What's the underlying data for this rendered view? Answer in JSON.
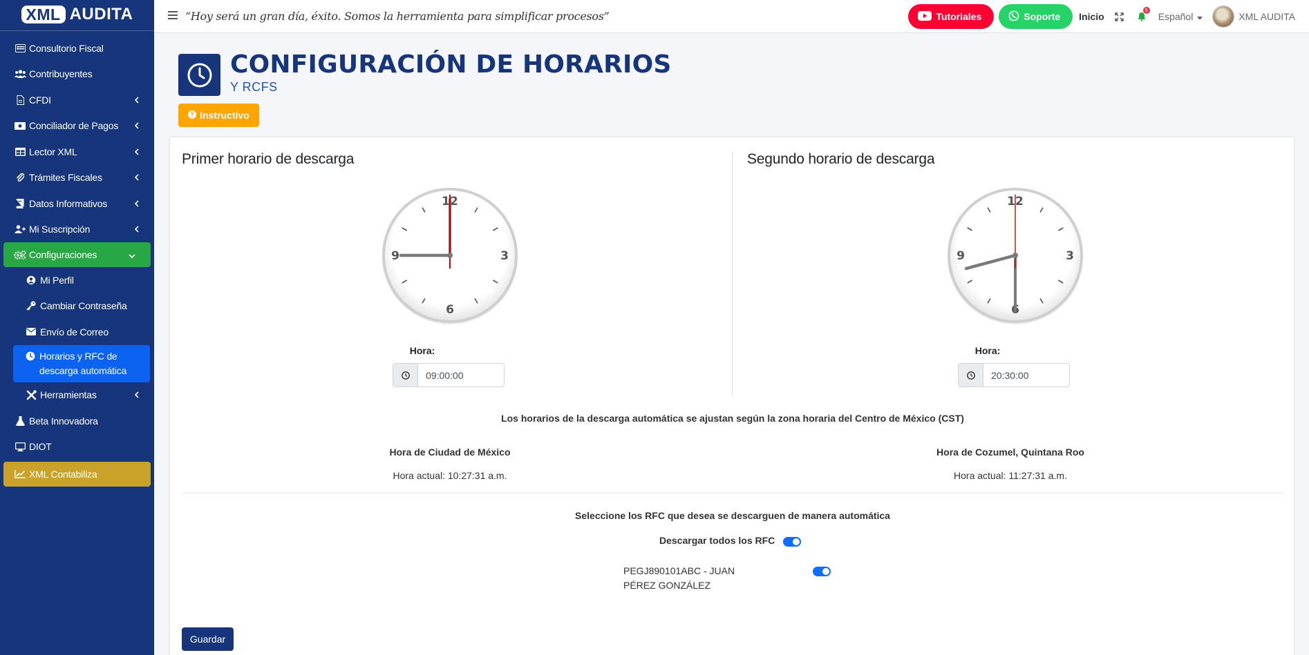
{
  "brand": {
    "part1": "XML",
    "part2": "AUDITA"
  },
  "topbar": {
    "motto": "“Hoy será un gran día, éxito. Somos la herramienta para simplificar procesos”",
    "tutoriales": "Tutoriales",
    "soporte": "Soporte",
    "inicio": "Inicio",
    "notif_count": "5",
    "language": "Español",
    "user": "XML AUDITA"
  },
  "sidebar": {
    "items": [
      {
        "label": "Consultorio Fiscal",
        "icon": "invoice-icon"
      },
      {
        "label": "Contribuyentes",
        "icon": "users-icon"
      },
      {
        "label": "CFDI",
        "icon": "file-icon"
      },
      {
        "label": "Conciliador de Pagos",
        "icon": "money-icon"
      },
      {
        "label": "Lector XML",
        "icon": "table-icon"
      },
      {
        "label": "Trámites Fiscales",
        "icon": "paperclip-icon"
      },
      {
        "label": "Datos Informativos",
        "icon": "book-icon"
      },
      {
        "label": "Mi Suscripción",
        "icon": "user-plus-icon"
      },
      {
        "label": "Configuraciones",
        "icon": "gears-icon"
      },
      {
        "label": "Mi Perfil",
        "icon": "user-circle-icon"
      },
      {
        "label": "Cambiar Contraseña",
        "icon": "key-icon"
      },
      {
        "label": "Envío de Correo",
        "icon": "envelope-icon"
      },
      {
        "label": "Horarios y RFC de descarga automática",
        "icon": "clock-icon"
      },
      {
        "label": "Herramientas",
        "icon": "tools-icon"
      },
      {
        "label": "Beta Innovadora",
        "icon": "flask-icon"
      },
      {
        "label": "DIOT",
        "icon": "desktop-icon"
      },
      {
        "label": "XML Contabiliza",
        "icon": "chart-line-icon"
      }
    ]
  },
  "header": {
    "title": "CONFIGURACIÓN DE HORARIOS",
    "subtitle": "Y RCFS",
    "instructivo": "Instructivo"
  },
  "schedules": {
    "first": {
      "title": "Primer horario de descarga",
      "label": "Hora:",
      "value": "09:00:00"
    },
    "second": {
      "title": "Segundo horario de descarga",
      "label": "Hora:",
      "value": "20:30:00"
    }
  },
  "clock_numbers": {
    "n12": "12",
    "n3": "3",
    "n6": "6",
    "n9": "9"
  },
  "timezone": {
    "note": "Los horarios de la descarga automática se ajustan según la zona horaria del Centro de México (CST)",
    "city1": "Hora de Ciudad de México",
    "now1": "Hora actual: 10:27:31 a.m.",
    "city2": "Hora de Cozumel, Quintana Roo",
    "now2": "Hora actual: 11:27:31 a.m."
  },
  "rfc": {
    "note": "Seleccione los RFC que desea se descarguen de manera automática",
    "all_label": "Descargar todos los RFC",
    "all_enabled": true,
    "items": [
      {
        "label": "PEGJ890101ABC - JUAN PÉREZ GONZÁLEZ",
        "enabled": true
      }
    ]
  },
  "actions": {
    "save": "Guardar"
  },
  "colors": {
    "sidebar": "#17357a",
    "green_active": "#28a745",
    "blue_active": "#0b63f0",
    "gold": "#c9a227",
    "youtube": "#ff0033",
    "whatsapp": "#25d366",
    "instructivo": "#ffa500"
  }
}
